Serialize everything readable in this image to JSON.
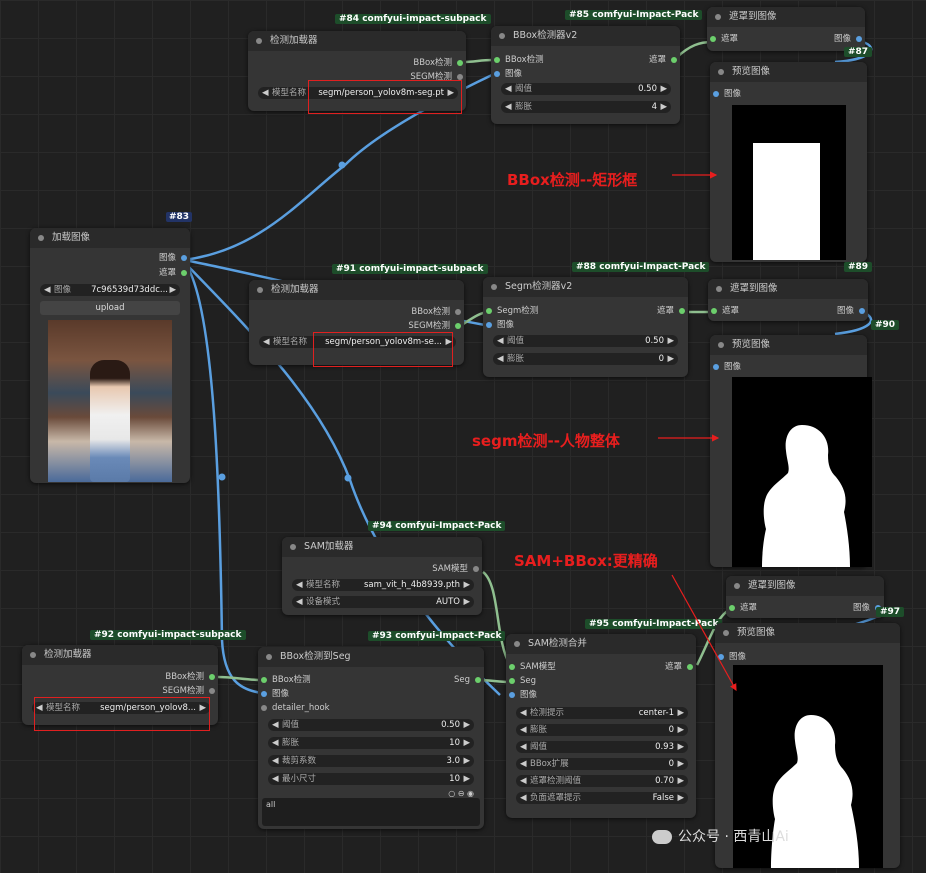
{
  "nodes": {
    "n83": {
      "id": "#83",
      "title": "加载图像",
      "out1": "图像",
      "out2": "遮罩",
      "image_label": "图像",
      "image_value": "7c96539d73ddc...",
      "upload": "upload"
    },
    "n84": {
      "id": "#84 comfyui-impact-subpack",
      "title": "检测加载器",
      "out1": "BBox检测",
      "out2": "SEGM检测",
      "model_label": "模型名称",
      "model_value": "segm/person_yolov8m-seg.pt"
    },
    "n85": {
      "id": "#85 comfyui-Impact-Pack",
      "title": "BBox检测器v2",
      "in1": "BBox检测",
      "in2": "图像",
      "out1": "遮罩",
      "w1_label": "阈值",
      "w1_value": "0.50",
      "w2_label": "膨胀",
      "w2_value": "4"
    },
    "n86": {
      "title": "遮罩到图像",
      "in1": "遮罩",
      "out1": "图像"
    },
    "n87": {
      "id": "#87",
      "title": "预览图像",
      "in1": "图像"
    },
    "n91": {
      "id": "#91 comfyui-impact-subpack",
      "title": "检测加载器",
      "out1": "BBox检测",
      "out2": "SEGM检测",
      "model_label": "模型名称",
      "model_value": "segm/person_yolov8m-se..."
    },
    "n88": {
      "id": "#88 comfyui-Impact-Pack",
      "title": "Segm检测器v2",
      "in1": "Segm检测",
      "in2": "图像",
      "out1": "遮罩",
      "w1_label": "阈值",
      "w1_value": "0.50",
      "w2_label": "膨胀",
      "w2_value": "0"
    },
    "n89": {
      "id": "#89",
      "title": "遮罩到图像",
      "in1": "遮罩",
      "out1": "图像"
    },
    "n90": {
      "id": "#90",
      "title": "预览图像",
      "in1": "图像"
    },
    "n94": {
      "id": "#94 comfyui-Impact-Pack",
      "title": "SAM加载器",
      "out1": "SAM模型",
      "w1_label": "模型名称",
      "w1_value": "sam_vit_h_4b8939.pth",
      "w2_label": "设备模式",
      "w2_value": "AUTO"
    },
    "n92": {
      "id": "#92 comfyui-impact-subpack",
      "title": "检测加载器",
      "out1": "BBox检测",
      "out2": "SEGM检测",
      "model_label": "模型名称",
      "model_value": "segm/person_yolov8..."
    },
    "n93": {
      "id": "#93 comfyui-Impact-Pack",
      "title": "BBox检测到Seg",
      "in1": "BBox检测",
      "in2": "图像",
      "in3": "detailer_hook",
      "out1": "Seg",
      "widgets": [
        {
          "label": "阈值",
          "value": "0.50"
        },
        {
          "label": "膨胀",
          "value": "10"
        },
        {
          "label": "裁剪系数",
          "value": "3.0"
        },
        {
          "label": "最小尺寸",
          "value": "10"
        }
      ],
      "textarea": "all"
    },
    "n95": {
      "id": "#95 comfyui-Impact-Pack",
      "title": "SAM检测合并",
      "in1": "SAM模型",
      "in2": "Seg",
      "in3": "图像",
      "out1": "遮罩",
      "widgets": [
        {
          "label": "检测提示",
          "value": "center-1"
        },
        {
          "label": "膨胀",
          "value": "0"
        },
        {
          "label": "阈值",
          "value": "0.93"
        },
        {
          "label": "BBox扩展",
          "value": "0"
        },
        {
          "label": "遮罩检测阈值",
          "value": "0.70"
        },
        {
          "label": "负面遮罩提示",
          "value": "False"
        }
      ]
    },
    "n96": {
      "title": "遮罩到图像",
      "in1": "遮罩",
      "out1": "图像"
    },
    "n97": {
      "id": "#97",
      "title": "预览图像",
      "in1": "图像"
    }
  },
  "annotations": {
    "a1": "BBox检测--矩形框",
    "a2": "segm检测--人物整体",
    "a3": "SAM+BBox:更精确"
  },
  "watermark": "公众号 · 西青山Ai",
  "colors": {
    "accent_red": "#e81e1e",
    "wire_blue": "#5a9fe0",
    "wire_green": "#8fbf8f",
    "socket_green": "#6ccf6c"
  }
}
